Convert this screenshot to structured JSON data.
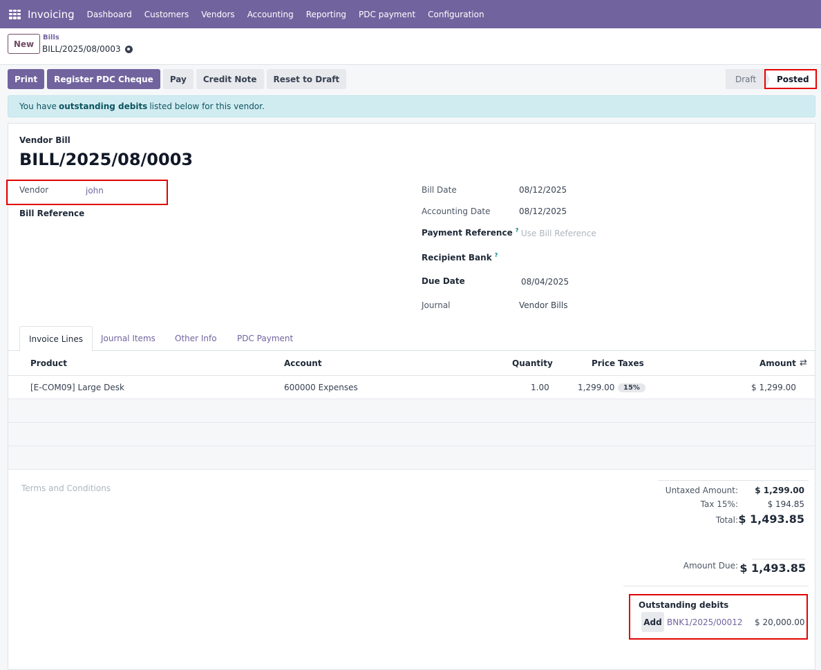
{
  "navbar": {
    "app_name": "Invoicing",
    "items": [
      "Dashboard",
      "Customers",
      "Vendors",
      "Accounting",
      "Reporting",
      "PDC payment",
      "Configuration"
    ]
  },
  "control": {
    "new_label": "New",
    "breadcrumb_parent": "Bills",
    "breadcrumb_current": "BILL/2025/08/0003"
  },
  "actions": {
    "buttons": [
      "Print",
      "Register PDC Cheque",
      "Pay",
      "Credit Note",
      "Reset to Draft"
    ]
  },
  "status": {
    "stages": [
      "Draft",
      "Posted"
    ],
    "current": "Posted"
  },
  "alert": {
    "prefix": "You have",
    "bold": "outstanding debits",
    "suffix": "listed below for this vendor."
  },
  "form": {
    "doc_type": "Vendor Bill",
    "doc_name": "BILL/2025/08/0003",
    "vendor_label": "Vendor",
    "vendor_value": "john",
    "bill_reference_label": "Bill Reference",
    "bill_date_label": "Bill Date",
    "bill_date_value": "08/12/2025",
    "accounting_date_label": "Accounting Date",
    "accounting_date_value": "08/12/2025",
    "payment_reference_label": "Payment Reference",
    "payment_reference_placeholder": "Use Bill Reference",
    "recipient_bank_label": "Recipient Bank",
    "due_date_label": "Due Date",
    "due_date_value": "08/04/2025",
    "journal_label": "Journal",
    "journal_value": "Vendor Bills",
    "help_mark": "?"
  },
  "tabs": [
    "Invoice Lines",
    "Journal Items",
    "Other Info",
    "PDC Payment"
  ],
  "table": {
    "headers": {
      "product": "Product",
      "account": "Account",
      "quantity": "Quantity",
      "price": "Price",
      "taxes": "Taxes",
      "amount": "Amount"
    },
    "rows": [
      {
        "product": "[E-COM09] Large Desk",
        "account": "600000 Expenses",
        "quantity": "1.00",
        "price": "1,299.00",
        "tax": "15%",
        "amount": "$ 1,299.00"
      }
    ]
  },
  "terms_placeholder": "Terms and Conditions",
  "totals": {
    "untaxed_label": "Untaxed Amount:",
    "untaxed_value": "$ 1,299.00",
    "tax_label": "Tax 15%:",
    "tax_value": "$ 194.85",
    "total_label": "Total:",
    "total_value": "$ 1,493.85",
    "amount_due_label": "Amount Due:",
    "amount_due_value": "$ 1,493.85"
  },
  "outstanding": {
    "title": "Outstanding debits",
    "add_label": "Add",
    "reference": "BNK1/2025/00012",
    "amount": "$ 20,000.00"
  },
  "colors": {
    "navbar": "#71639e",
    "primary": "#71639e",
    "alert_bg": "#d1ecf1",
    "highlight": "#e30000"
  }
}
